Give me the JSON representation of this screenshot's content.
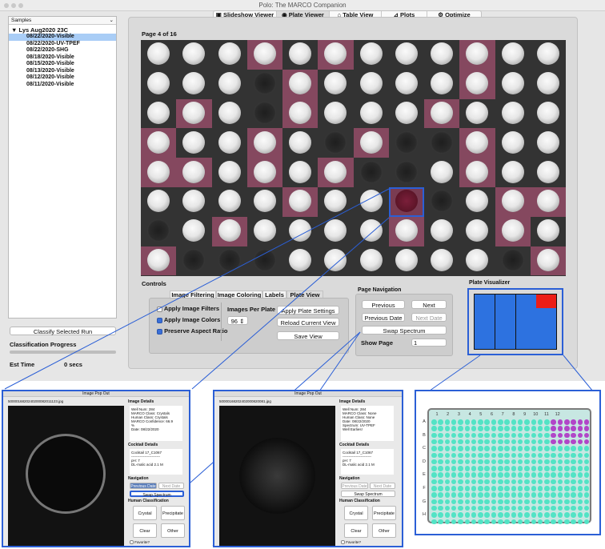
{
  "window": {
    "title": "Polo: The MARCO Companion"
  },
  "tabs": [
    {
      "label": "Slideshow Viewer",
      "icon": "slideshow-icon"
    },
    {
      "label": "Plate Viewer",
      "icon": "eye-icon",
      "active": true
    },
    {
      "label": "Table View",
      "icon": "table-icon"
    },
    {
      "label": "Plots",
      "icon": "plot-icon"
    },
    {
      "label": "Optimize",
      "icon": "gear-icon"
    }
  ],
  "sidebar": {
    "header": "Samples",
    "root": "Lys Aug2020 23C",
    "items": [
      "08/22/2020-Visible",
      "08/22/2020-UV-TPEF",
      "08/22/2020-SHG",
      "08/18/2020-Visible",
      "08/15/2020-Visible",
      "08/13/2020-Visible",
      "08/12/2020-Visible",
      "08/11/2020-Visible"
    ],
    "selected_index": 0,
    "classify_button": "Classify Selected Run",
    "progress_label": "Classification Progress",
    "progress_value": 0,
    "est_time_label": "Est Time",
    "est_time_value": "0 secs"
  },
  "viewer": {
    "page_label": "Page 4 of 16"
  },
  "controls": {
    "title": "Controls",
    "tabs": [
      "Image Filtering",
      "Image Coloring",
      "Labels",
      "Plate View"
    ],
    "apply_filters": "Apply Image Filters",
    "apply_colors": "Apply Image Colors",
    "preserve_aspect": "Preserve Aspect Ratio",
    "images_per_plate_label": "Images Per Plate",
    "images_per_plate_value": "96",
    "apply_plate_settings": "Apply Plate Settings",
    "reload_view": "Reload Current View",
    "save_view": "Save View"
  },
  "page_navigation": {
    "title": "Page Navigation",
    "previous": "Previous",
    "next": "Next",
    "previous_date": "Previous Date",
    "next_date": "Next Date",
    "swap_spectrum": "Swap Spectrum",
    "show_page_label": "Show Page",
    "show_page_value": "1"
  },
  "plate_visualizer": {
    "title": "Plate Visualizer"
  },
  "popup_left": {
    "title": "Image Pop Out",
    "filename": "5000016820240200082011123.jpg",
    "image_details_title": "Image Details",
    "details": [
      "Well Num: 284",
      "MARCO Class: Crystals",
      "Human Class: Crystals",
      "MARCO Confidence: 66.9",
      "%",
      "Date: 08/22/2020"
    ],
    "cocktail_title": "Cocktail Details",
    "cocktail": [
      "Cocktail 17_C1067",
      "------------------------",
      "pH: 7",
      "DL-malic acid 2.1 M"
    ],
    "navigation_title": "Navigation",
    "prev_date": "Previous Date",
    "next_date": "Next Date",
    "swap": "Swap Spectrum",
    "human_class_title": "Human Classification",
    "crystal": "Crystal",
    "precipitate": "Precipitate",
    "clear": "Clear",
    "other": "Other",
    "favorite": "Favorite?"
  },
  "popup_right": {
    "title": "Image Pop Out",
    "filename": "50000168202402000820081.jpg",
    "image_details_title": "Image Details",
    "details": [
      "Well Num: 284",
      "MARCO Class: None",
      "Human Class: None",
      "Date: 08/22/2020",
      "Spectrum: UV-TPEF",
      "Well Earlies!"
    ],
    "cocktail_title": "Cocktail Details",
    "cocktail": [
      "Cocktail 17_C1067",
      "------------------------",
      "pH: 7",
      "DL-malic acid 2.1 M"
    ],
    "navigation_title": "Navigation",
    "prev_date": "Previous Date",
    "next_date": "Next Date",
    "swap": "Swap Spectrum",
    "human_class_title": "Human Classification",
    "crystal": "Crystal",
    "precipitate": "Precipitate",
    "clear": "Clear",
    "other": "Other",
    "favorite": "Favorite?"
  },
  "plate_map": {
    "columns": [
      "1",
      "2",
      "3",
      "4",
      "5",
      "6",
      "7",
      "8",
      "9",
      "10",
      "11",
      "12"
    ],
    "rows": [
      "A",
      "B",
      "C",
      "D",
      "E",
      "F",
      "G",
      "H"
    ]
  }
}
